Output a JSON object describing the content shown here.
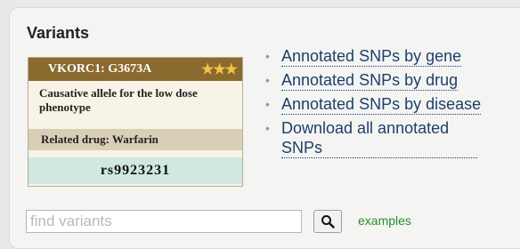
{
  "panel": {
    "title": "Variants"
  },
  "variant_card": {
    "gene": "VKORC1: G3673A",
    "stars": "★★★",
    "description": "Causative allele for the low dose phenotype",
    "related_drug": "Related drug: Warfarin",
    "rsid": "rs9923231",
    "header_color": "#8a6a2e",
    "rsid_bg_color": "#cfe8e2"
  },
  "links": [
    {
      "label": "Annotated SNPs by gene"
    },
    {
      "label": "Annotated SNPs by drug"
    },
    {
      "label": "Annotated SNPs by disease"
    },
    {
      "label": "Download all annotated SNPs"
    }
  ],
  "search": {
    "placeholder": "find variants",
    "button_icon": "search-icon",
    "examples_label": "examples"
  }
}
